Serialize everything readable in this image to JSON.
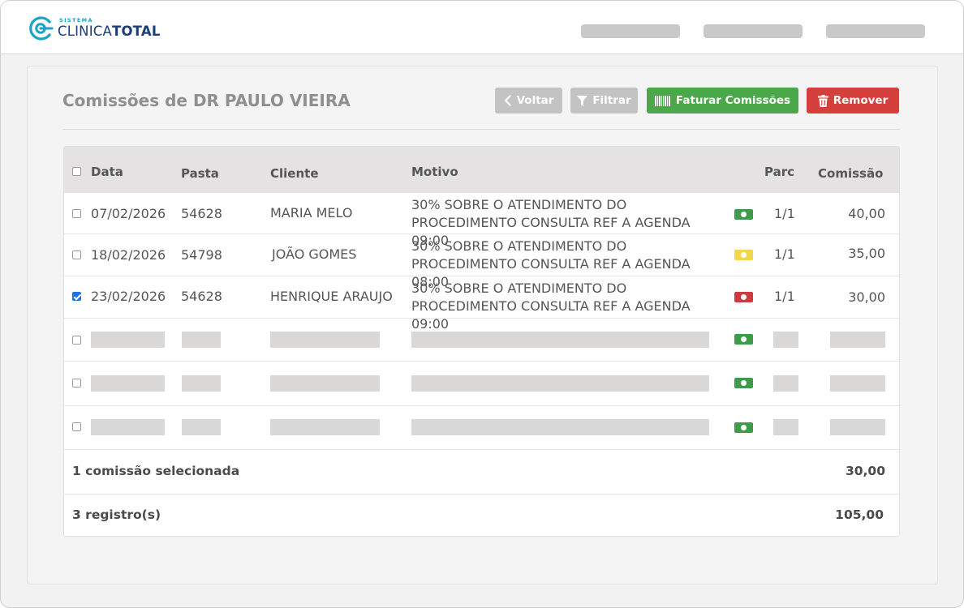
{
  "app": {
    "logo_small": "SISTEMA",
    "logo_thin": "CLINICA",
    "logo_bold": "TOTAL",
    "brand_colors": {
      "primary": "#1d3d7a",
      "accent": "#1aa3c9"
    }
  },
  "header": {
    "title": "Comissões de DR PAULO VIEIRA"
  },
  "toolbar": {
    "voltar_label": "Voltar",
    "filtrar_label": "Filtrar",
    "faturar_label": "Faturar Comissões",
    "remover_label": "Remover",
    "colors": {
      "disabled": "#c3c3c3",
      "success": "#4aa84a",
      "danger": "#d6403c"
    }
  },
  "table": {
    "columns": {
      "data": "Data",
      "pasta": "Pasta",
      "cliente": "Cliente",
      "motivo": "Motivo",
      "parc": "Parc",
      "comissao": "Comissão"
    },
    "rows": [
      {
        "checked": false,
        "data": "07/02/2026",
        "pasta": "54628",
        "cliente": "MARIA MELO",
        "motivo": "30% SOBRE O ATENDIMENTO DO PROCEDIMENTO CONSULTA REF A AGENDA 09:00",
        "status_icon": "money-green-icon",
        "parc": "1/1",
        "comissao": "40,00"
      },
      {
        "checked": false,
        "data": "18/02/2026",
        "pasta": "54798",
        "cliente": "JOÃO GOMES",
        "motivo": "30% SOBRE O ATENDIMENTO DO PROCEDIMENTO CONSULTA REF A AGENDA 08:00",
        "status_icon": "money-yellow-icon",
        "parc": "1/1",
        "comissao": "35,00"
      },
      {
        "checked": true,
        "data": "23/02/2026",
        "pasta": "54628",
        "cliente": "HENRIQUE ARAUJO",
        "motivo": "30% SOBRE O ATENDIMENTO DO PROCEDIMENTO CONSULTA REF A AGENDA 09:00",
        "status_icon": "money-red-icon",
        "parc": "1/1",
        "comissao": "30,00"
      }
    ],
    "placeholder_rows": 3
  },
  "footer": {
    "selected_label": "1 comissão selecionada",
    "selected_total": "30,00",
    "records_label": "3 registro(s)",
    "records_total": "105,00"
  }
}
